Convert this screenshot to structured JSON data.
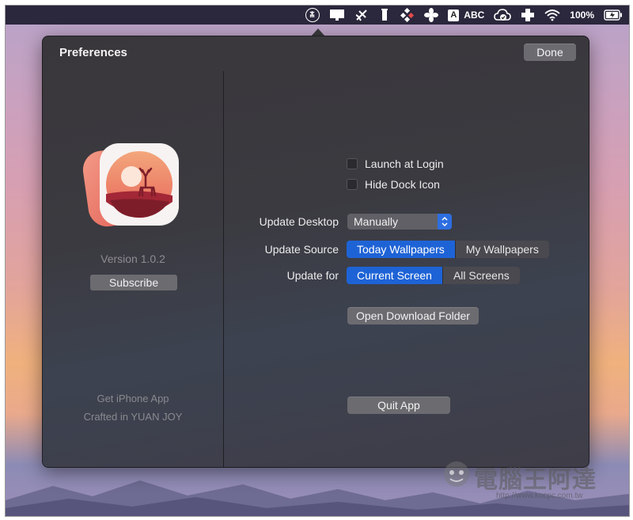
{
  "menubar": {
    "icons": [
      "deer-wallpaper-icon",
      "display-icon",
      "satellite-icon",
      "tower-icon",
      "tools-icon",
      "fan-icon",
      "input-source-icon",
      "cloud-check-icon",
      "plus-icon",
      "wifi-icon",
      "battery-icon"
    ],
    "input_letter": "A",
    "input_label": "ABC",
    "battery_percent": "100%"
  },
  "popover": {
    "title": "Preferences",
    "done_label": "Done"
  },
  "left": {
    "version": "Version 1.0.2",
    "subscribe_label": "Subscribe",
    "get_iphone_app": "Get iPhone App",
    "crafted": "Crafted in YUAN JOY"
  },
  "settings": {
    "launch_at_login": "Launch at Login",
    "hide_dock_icon": "Hide Dock Icon",
    "update_desktop_label": "Update Desktop",
    "update_desktop_value": "Manually",
    "update_source_label": "Update Source",
    "update_source_options": [
      "Today Wallpapers",
      "My Wallpapers"
    ],
    "update_source_selected": "Today Wallpapers",
    "update_for_label": "Update for",
    "update_for_options": [
      "Current Screen",
      "All Screens"
    ],
    "update_for_selected": "Current Screen",
    "open_download_folder": "Open Download Folder",
    "quit_app": "Quit App"
  },
  "watermark": {
    "text": "電腦王阿達",
    "url": "http://www.kocpc.com.tw"
  },
  "colors": {
    "accent": "#1e63d6",
    "popover_bg": "#39373b"
  }
}
